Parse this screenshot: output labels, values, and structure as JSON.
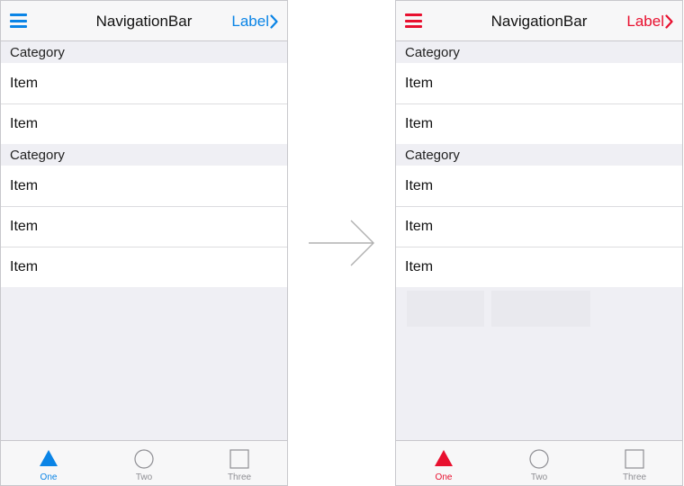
{
  "colors": {
    "left_accent": "#0a84e6",
    "right_accent": "#e8102f"
  },
  "phones": [
    {
      "navbar": {
        "menu_icon": "hamburger-icon",
        "title": "NavigationBar",
        "right_label": "Label",
        "right_icon": "chevron-right-icon"
      },
      "sections": [
        {
          "category": "Category",
          "items": [
            "Item",
            "Item"
          ]
        },
        {
          "category": "Category",
          "items": [
            "Item",
            "Item",
            "Item"
          ]
        }
      ],
      "tabs": [
        {
          "label": "One",
          "icon": "triangle-icon",
          "selected": true
        },
        {
          "label": "Two",
          "icon": "circle-icon",
          "selected": false
        },
        {
          "label": "Three",
          "icon": "square-icon",
          "selected": false
        }
      ]
    },
    {
      "navbar": {
        "menu_icon": "hamburger-icon",
        "title": "NavigationBar",
        "right_label": "Label",
        "right_icon": "chevron-right-icon"
      },
      "sections": [
        {
          "category": "Category",
          "items": [
            "Item",
            "Item"
          ]
        },
        {
          "category": "Category",
          "items": [
            "Item",
            "Item",
            "Item"
          ]
        }
      ],
      "tabs": [
        {
          "label": "One",
          "icon": "triangle-icon",
          "selected": true
        },
        {
          "label": "Two",
          "icon": "circle-icon",
          "selected": false
        },
        {
          "label": "Three",
          "icon": "square-icon",
          "selected": false
        }
      ]
    }
  ],
  "transition_icon": "arrow-right-icon"
}
